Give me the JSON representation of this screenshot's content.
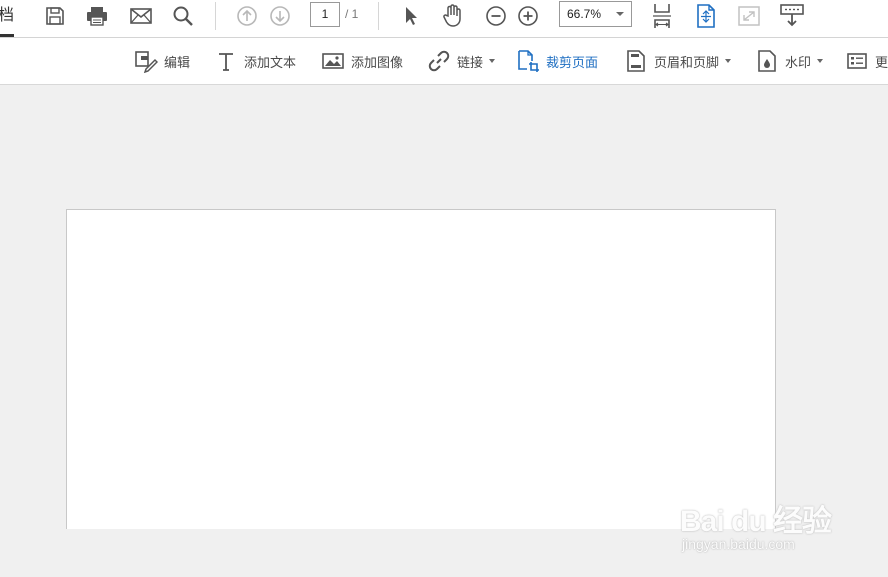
{
  "topbar": {
    "doc_tab_label": "档",
    "page_number": "1",
    "page_total": "/ 1",
    "zoom_value": "66.7%"
  },
  "tools": {
    "edit": "编辑",
    "add_text": "添加文本",
    "add_image": "添加图像",
    "link": "链接",
    "crop_page": "裁剪页面",
    "header_footer": "页眉和页脚",
    "watermark": "水印",
    "more": "更"
  },
  "watermark": {
    "main": "Bai du 经验",
    "sub": "jingyan.baidu.com"
  },
  "colors": {
    "accent": "#1f6fc2",
    "icon": "#555555",
    "disabled": "#b8b8b8",
    "background": "#f0f0f0"
  }
}
